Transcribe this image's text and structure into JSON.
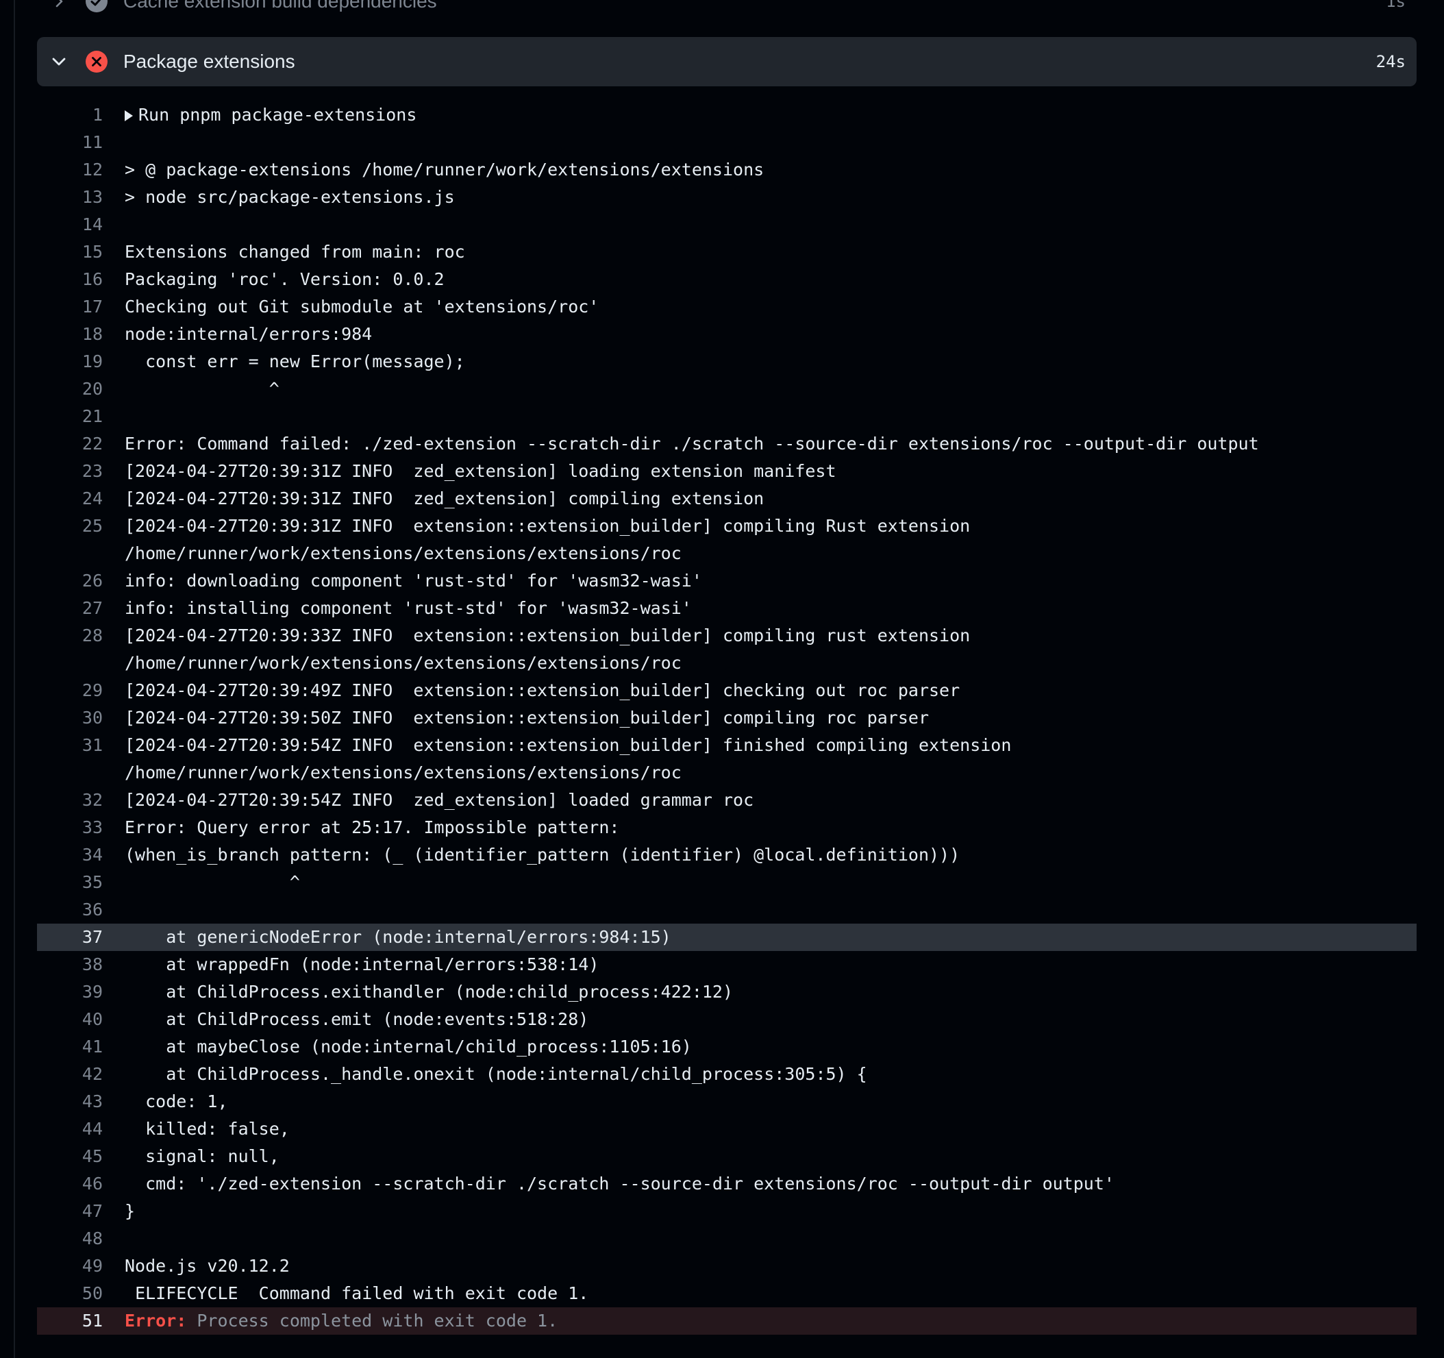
{
  "steps": {
    "previous": {
      "title": "Cache extension build dependencies",
      "duration": "1s",
      "status_icon": "check-circle-icon",
      "chevron": "chevron-right-icon"
    },
    "current": {
      "title": "Package extensions",
      "duration": "24s",
      "status_icon": "x-circle-icon",
      "chevron": "chevron-down-icon"
    }
  },
  "colors": {
    "error_red": "#f85149",
    "success_gray": "#7d8590",
    "step_header_bg": "#21262d",
    "highlight_bg": "#2d333b"
  },
  "log": {
    "line_1": {
      "num": "1",
      "text": "Run pnpm package-extensions"
    },
    "line_11": {
      "num": "11",
      "text": ""
    },
    "line_12": {
      "num": "12",
      "text": "> @ package-extensions /home/runner/work/extensions/extensions"
    },
    "line_13": {
      "num": "13",
      "text": "> node src/package-extensions.js"
    },
    "line_14": {
      "num": "14",
      "text": ""
    },
    "line_15": {
      "num": "15",
      "text": "Extensions changed from main: roc"
    },
    "line_16": {
      "num": "16",
      "text": "Packaging 'roc'. Version: 0.0.2"
    },
    "line_17": {
      "num": "17",
      "text": "Checking out Git submodule at 'extensions/roc'"
    },
    "line_18": {
      "num": "18",
      "text": "node:internal/errors:984"
    },
    "line_19": {
      "num": "19",
      "text": "  const err = new Error(message);"
    },
    "line_20": {
      "num": "20",
      "text": "              ^"
    },
    "line_21": {
      "num": "21",
      "text": ""
    },
    "line_22": {
      "num": "22",
      "text": "Error: Command failed: ./zed-extension --scratch-dir ./scratch --source-dir extensions/roc --output-dir output"
    },
    "line_23": {
      "num": "23",
      "text": "[2024-04-27T20:39:31Z INFO  zed_extension] loading extension manifest"
    },
    "line_24": {
      "num": "24",
      "text": "[2024-04-27T20:39:31Z INFO  zed_extension] compiling extension"
    },
    "line_25": {
      "num": "25",
      "text": "[2024-04-27T20:39:31Z INFO  extension::extension_builder] compiling Rust extension\n/home/runner/work/extensions/extensions/extensions/roc"
    },
    "line_26": {
      "num": "26",
      "text": "info: downloading component 'rust-std' for 'wasm32-wasi'"
    },
    "line_27": {
      "num": "27",
      "text": "info: installing component 'rust-std' for 'wasm32-wasi'"
    },
    "line_28": {
      "num": "28",
      "text": "[2024-04-27T20:39:33Z INFO  extension::extension_builder] compiling rust extension\n/home/runner/work/extensions/extensions/extensions/roc"
    },
    "line_29": {
      "num": "29",
      "text": "[2024-04-27T20:39:49Z INFO  extension::extension_builder] checking out roc parser"
    },
    "line_30": {
      "num": "30",
      "text": "[2024-04-27T20:39:50Z INFO  extension::extension_builder] compiling roc parser"
    },
    "line_31": {
      "num": "31",
      "text": "[2024-04-27T20:39:54Z INFO  extension::extension_builder] finished compiling extension\n/home/runner/work/extensions/extensions/extensions/roc"
    },
    "line_32": {
      "num": "32",
      "text": "[2024-04-27T20:39:54Z INFO  zed_extension] loaded grammar roc"
    },
    "line_33": {
      "num": "33",
      "text": "Error: Query error at 25:17. Impossible pattern:"
    },
    "line_34": {
      "num": "34",
      "text": "(when_is_branch pattern: (_ (identifier_pattern (identifier) @local.definition)))"
    },
    "line_35": {
      "num": "35",
      "text": "                ^"
    },
    "line_36": {
      "num": "36",
      "text": ""
    },
    "line_37": {
      "num": "37",
      "text": "    at genericNodeError (node:internal/errors:984:15)"
    },
    "line_38": {
      "num": "38",
      "text": "    at wrappedFn (node:internal/errors:538:14)"
    },
    "line_39": {
      "num": "39",
      "text": "    at ChildProcess.exithandler (node:child_process:422:12)"
    },
    "line_40": {
      "num": "40",
      "text": "    at ChildProcess.emit (node:events:518:28)"
    },
    "line_41": {
      "num": "41",
      "text": "    at maybeClose (node:internal/child_process:1105:16)"
    },
    "line_42": {
      "num": "42",
      "text": "    at ChildProcess._handle.onexit (node:internal/child_process:305:5) {"
    },
    "line_43": {
      "num": "43",
      "text": "  code: 1,"
    },
    "line_44": {
      "num": "44",
      "text": "  killed: false,"
    },
    "line_45": {
      "num": "45",
      "text": "  signal: null,"
    },
    "line_46": {
      "num": "46",
      "text": "  cmd: './zed-extension --scratch-dir ./scratch --source-dir extensions/roc --output-dir output'"
    },
    "line_47": {
      "num": "47",
      "text": "}"
    },
    "line_48": {
      "num": "48",
      "text": ""
    },
    "line_49": {
      "num": "49",
      "text": "Node.js v20.12.2"
    },
    "line_50": {
      "num": "50",
      "text": " ELIFECYCLE  Command failed with exit code 1."
    },
    "line_51": {
      "num": "51",
      "label": "Error:",
      "text": " Process completed with exit code 1."
    }
  }
}
